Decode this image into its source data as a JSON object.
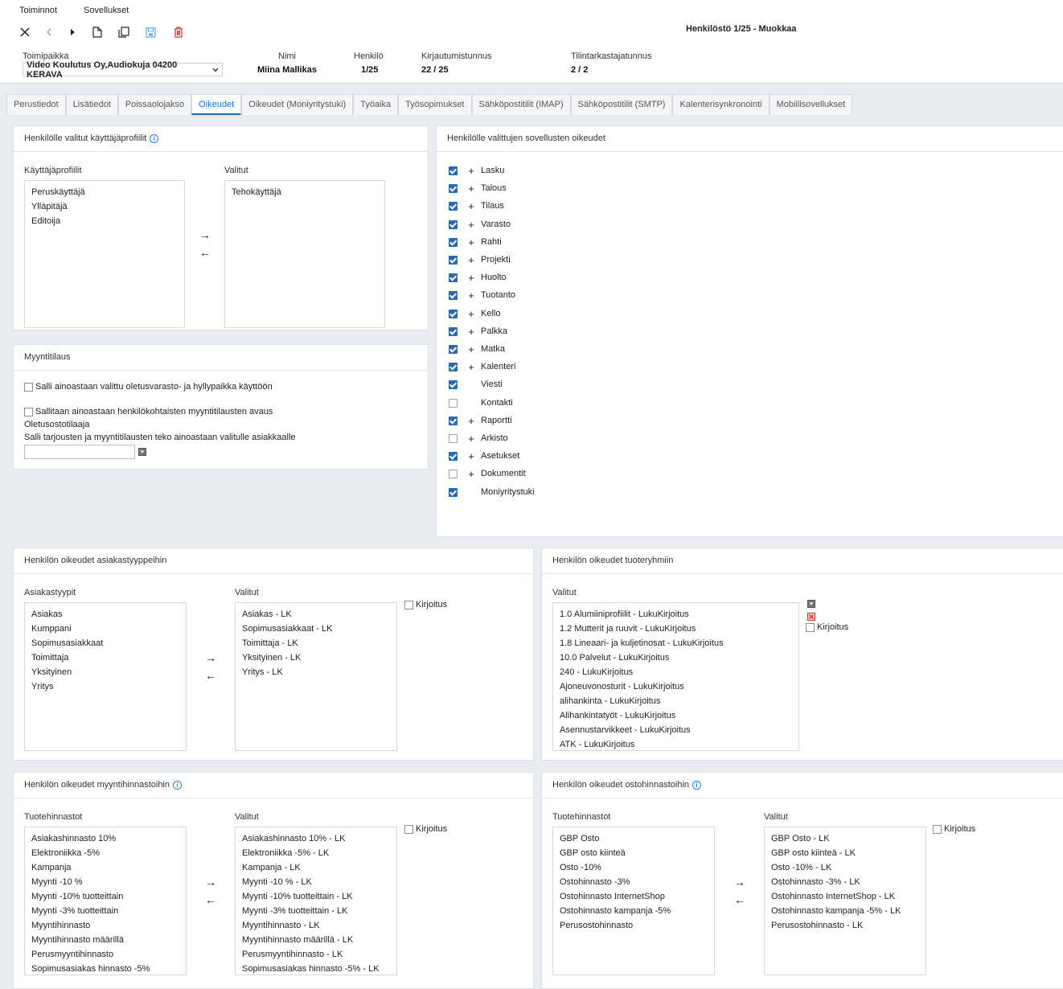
{
  "menu": [
    "Toiminnot",
    "Sovellukset"
  ],
  "toolbar_icons": [
    "close-icon",
    "prev-icon",
    "next-icon",
    "new-icon",
    "copy-icon",
    "save-icon",
    "delete-icon"
  ],
  "page_title": "Henkilöstö 1/25 - Muokkaa",
  "header": {
    "company_label": "Toimipaikka",
    "company_value": "Video Koulutus Oy,Audiokuja 04200 KERAVA",
    "name_label": "Nimi",
    "name_value": "Miina Mallikas",
    "person_label": "Henkilö",
    "person_value": "1/25",
    "login_label": "Kirjautumistunnus",
    "login_value": "22 / 25",
    "auditor_label": "Tilintarkastajatunnus",
    "auditor_value": "2 / 2"
  },
  "tabs": [
    "Perustiedot",
    "Lisätiedot",
    "Poissaolojakso",
    "Oikeudet",
    "Oikeudet (Moniyritystuki)",
    "Työaika",
    "Työsopimukset",
    "Sähköpostitilit (IMAP)",
    "Sähköpostitilit (SMTP)",
    "Kalenterisynkronointi",
    "Mobiilisovellukset"
  ],
  "active_tab": "Oikeudet",
  "profiles": {
    "title": "Henkilölle valitut käyttäjäprofiilit",
    "left_label": "Käyttäjäprofiilit",
    "left_items": [
      "Peruskäyttäjä",
      "Ylläpitäjä",
      "Editoija"
    ],
    "right_label": "Valitut",
    "right_items": [
      "Tehokäyttäjä"
    ]
  },
  "sales_order": {
    "title": "Myyntitilaus",
    "option1": "Salli ainoastaan valittu oletusvarasto- ja hyllypaikka käyttöön",
    "option2": "Sallitaan ainoastaan henkilökohtaisten myyntitilausten avaus",
    "line3": "Oletusostotilaaja",
    "line4": "Salli tarjousten ja myyntitilausten teko ainoastaan valitulle asiakkaalle",
    "select_value": ""
  },
  "app_rights": {
    "title": "Henkilölle valittujen sovellusten oikeudet",
    "apps": [
      {
        "name": "Lasku",
        "checked": true,
        "expandable": true
      },
      {
        "name": "Talous",
        "checked": true,
        "expandable": true
      },
      {
        "name": "Tilaus",
        "checked": true,
        "expandable": true
      },
      {
        "name": "Varasto",
        "checked": true,
        "expandable": true
      },
      {
        "name": "Rahti",
        "checked": true,
        "expandable": true
      },
      {
        "name": "Projekti",
        "checked": true,
        "expandable": true
      },
      {
        "name": "Huolto",
        "checked": true,
        "expandable": true
      },
      {
        "name": "Tuotanto",
        "checked": true,
        "expandable": true
      },
      {
        "name": "Kello",
        "checked": true,
        "expandable": true
      },
      {
        "name": "Palkka",
        "checked": true,
        "expandable": true
      },
      {
        "name": "Matka",
        "checked": true,
        "expandable": true
      },
      {
        "name": "Kalenteri",
        "checked": true,
        "expandable": true
      },
      {
        "name": "Viesti",
        "checked": true,
        "expandable": false
      },
      {
        "name": "Kontakti",
        "checked": false,
        "expandable": false
      },
      {
        "name": "Raportti",
        "checked": true,
        "expandable": true
      },
      {
        "name": "Arkisto",
        "checked": false,
        "expandable": true
      },
      {
        "name": "Asetukset",
        "checked": true,
        "expandable": true
      },
      {
        "name": "Dokumentit",
        "checked": false,
        "expandable": true
      },
      {
        "name": "Moniyritystuki",
        "checked": true,
        "expandable": false
      }
    ]
  },
  "customer_types": {
    "title": "Henkilön oikeudet asiakastyyppeihin",
    "left_label": "Asiakastyypit",
    "left_items": [
      "Asiakas",
      "Kumppani",
      "Sopimusasiakkaat",
      "Toimittaja",
      "Yksityinen",
      "Yritys"
    ],
    "right_label": "Valitut",
    "right_items": [
      "Asiakas - LK",
      "Sopimusasiakkaat - LK",
      "Toimittaja - LK",
      "Yksityinen - LK",
      "Yritys - LK"
    ],
    "write_label": "Kirjoitus"
  },
  "product_groups": {
    "title": "Henkilön oikeudet tuoteryhmiin",
    "label": "Valitut",
    "items": [
      "1.0 Alumiiniprofiilit - LukuKirjoitus",
      "1.2 Mutterit ja ruuvit - LukuKirjoitus",
      "1.8 Lineaari- ja kuljetinosat - LukuKirjoitus",
      "10.0 Palvelut - LukuKirjoitus",
      "240 - LukuKirjoitus",
      "Ajoneuvonosturit - LukuKirjoitus",
      "alihankinta - LukuKirjoitus",
      "Alihankintatyöt - LukuKirjoitus",
      "Asennustarvikkeet - LukuKirjoitus",
      "ATK - LukuKirjoitus"
    ],
    "write_label": "Kirjoitus"
  },
  "sales_prices": {
    "title": "Henkilön oikeudet myyntihinnastoihin",
    "left_label": "Tuotehinnastot",
    "left_items": [
      "Asiakashinnasto 10%",
      "Elektroniikka -5%",
      "Kampanja",
      "Myynti -10 %",
      "Myynti -10% tuotteittain",
      "Myynti -3% tuotteittain",
      "Myyntihinnasto",
      "Myyntihinnasto määrillä",
      "Perusmyyntihinnasto",
      "Sopimusasiakas hinnasto -5%"
    ],
    "right_label": "Valitut",
    "right_items": [
      "Asiakashinnasto 10% - LK",
      "Elektroniikka -5% - LK",
      "Kampanja - LK",
      "Myynti -10 % - LK",
      "Myynti -10% tuotteittain - LK",
      "Myynti -3% tuotteittain - LK",
      "Myyntihinnasto - LK",
      "Myyntihinnasto määrillä - LK",
      "Perusmyyntihinnasto - LK",
      "Sopimusasiakas hinnasto -5% - LK"
    ],
    "write_label": "Kirjoitus"
  },
  "purchase_prices": {
    "title": "Henkilön oikeudet ostohinnastoihin",
    "left_label": "Tuotehinnastot",
    "left_items": [
      "GBP Osto",
      "GBP osto kiinteä",
      "Osto -10%",
      "Ostohinnasto -3%",
      "Ostohinnasto InternetShop",
      "Ostohinnasto kampanja -5%",
      "Perusostohinnasto"
    ],
    "right_label": "Valitut",
    "right_items": [
      "GBP Osto - LK",
      "GBP osto kiinteä - LK",
      "Osto -10% - LK",
      "Ostohinnasto -3% - LK",
      "Ostohinnasto InternetShop - LK",
      "Ostohinnasto kampanja -5% - LK",
      "Perusostohinnasto - LK"
    ],
    "write_label": "Kirjoitus"
  },
  "colors": {
    "accent": "#1a6fc9",
    "checkbox": "#2769b5",
    "delete": "#d9342b",
    "save": "#5aa9d6"
  }
}
